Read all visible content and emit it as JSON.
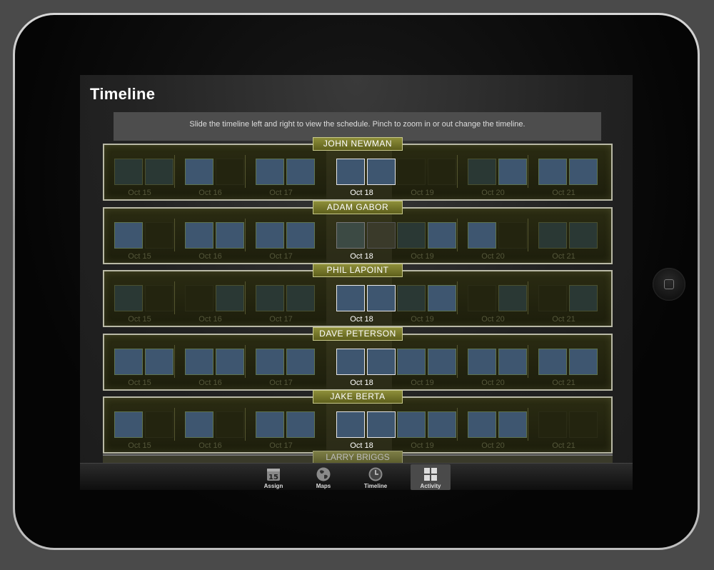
{
  "screen": {
    "title": "Timeline",
    "hint": "Slide the timeline left and right to view the schedule.  Pinch to zoom in or out change the timeline."
  },
  "days": [
    "Oct 15",
    "Oct 16",
    "Oct 17",
    "Oct 18",
    "Oct 19",
    "Oct 20",
    "Oct 21"
  ],
  "current_day": "Oct 18",
  "rows": [
    {
      "name": "JOHN NEWMAN",
      "slots": [
        [
          "dim",
          "dim"
        ],
        [
          "on",
          "off"
        ],
        [
          "on",
          "on"
        ],
        [
          "on",
          "on"
        ],
        [
          "off",
          "off"
        ],
        [
          "dim",
          "on"
        ],
        [
          "on",
          "on"
        ]
      ]
    },
    {
      "name": "ADAM GABOR",
      "slots": [
        [
          "on",
          "off"
        ],
        [
          "on",
          "on"
        ],
        [
          "on",
          "on"
        ],
        [
          "dim",
          "off"
        ],
        [
          "dim",
          "on"
        ],
        [
          "on",
          "off"
        ],
        [
          "dim",
          "dim"
        ]
      ]
    },
    {
      "name": "PHIL LAPOINT",
      "slots": [
        [
          "dim",
          "off"
        ],
        [
          "off",
          "dim"
        ],
        [
          "dim",
          "dim"
        ],
        [
          "on",
          "on"
        ],
        [
          "dim",
          "on"
        ],
        [
          "off",
          "dim"
        ],
        [
          "off",
          "dim"
        ]
      ]
    },
    {
      "name": "DAVE PETERSON",
      "slots": [
        [
          "on",
          "on"
        ],
        [
          "on",
          "on"
        ],
        [
          "on",
          "on"
        ],
        [
          "on",
          "on"
        ],
        [
          "on",
          "on"
        ],
        [
          "on",
          "on"
        ],
        [
          "on",
          "on"
        ]
      ]
    },
    {
      "name": "JAKE BERTA",
      "slots": [
        [
          "on",
          "off"
        ],
        [
          "on",
          "off"
        ],
        [
          "on",
          "on"
        ],
        [
          "on",
          "on"
        ],
        [
          "on",
          "on"
        ],
        [
          "on",
          "on"
        ],
        [
          "off",
          "off"
        ]
      ]
    }
  ],
  "peek_row": {
    "name": "LARRY BRIGGS"
  },
  "tabs": [
    {
      "label": "Assign",
      "icon": "calendar-icon",
      "icon_text": "15",
      "active": false
    },
    {
      "label": "Maps",
      "icon": "globe-icon",
      "active": false
    },
    {
      "label": "Timeline",
      "icon": "clock-icon",
      "active": false
    },
    {
      "label": "Activity",
      "icon": "grid-icon",
      "active": true
    }
  ]
}
